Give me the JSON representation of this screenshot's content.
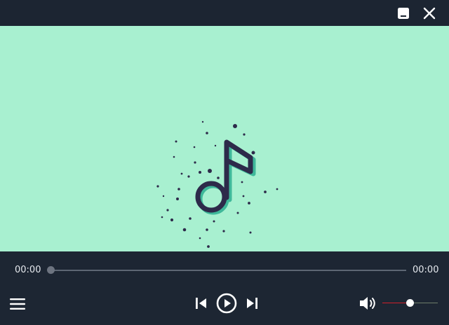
{
  "window": {
    "minimize_icon": "minimize-icon",
    "close_icon": "close-icon"
  },
  "artwork": {
    "icon": "music-note-icon",
    "background_color": "#a8f0d0",
    "note_color": "#2d2a4a",
    "accent_color": "#3fb89a"
  },
  "playback": {
    "current_time": "00:00",
    "total_time": "00:00",
    "progress": 0
  },
  "controls": {
    "menu_icon": "hamburger-menu-icon",
    "previous_icon": "skip-previous-icon",
    "play_icon": "play-icon",
    "next_icon": "skip-next-icon",
    "volume_icon": "volume-icon"
  },
  "volume": {
    "level": 0.5,
    "fill_color": "#d0202a"
  }
}
